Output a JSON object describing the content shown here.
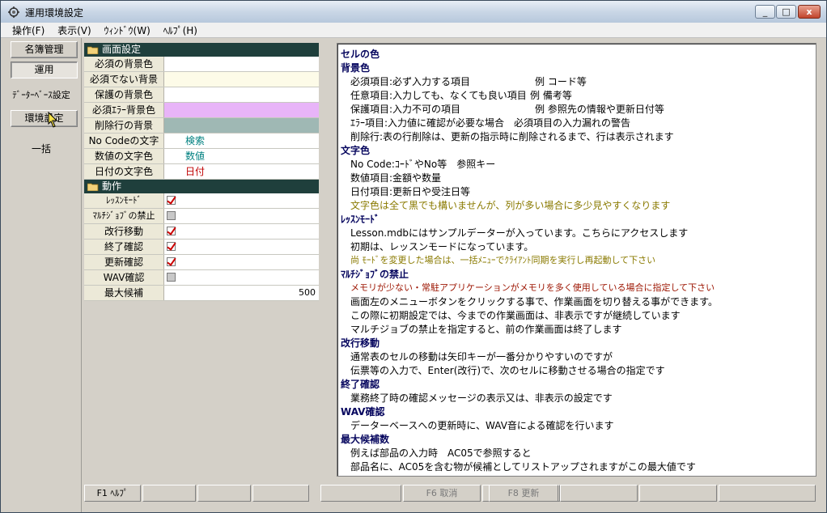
{
  "window": {
    "title": "運用環境設定",
    "icon": "app-icon",
    "buttons": {
      "minimize": "_",
      "maximize": "□",
      "close": "x"
    }
  },
  "menubar": [
    {
      "label": "操作(F)"
    },
    {
      "label": "表示(V)"
    },
    {
      "label": "ｳｨﾝﾄﾞｳ(W)"
    },
    {
      "label": "ﾍﾙﾌﾟ(H)"
    }
  ],
  "nav": {
    "master_label": "名簿管理",
    "operation_label": "運用",
    "db_settings_label": "ﾃﾞｰﾀｰﾍﾞｰｽ設定",
    "env_settings_label": "環境設定",
    "bulk_label": "一括"
  },
  "grid": {
    "screen_section": "画面設定",
    "required_bg": "必須の背景色",
    "optional_bg": "必須でない背景",
    "protected_bg": "保護の背景色",
    "required_error_bg": "必須ｴﾗｰ背景色",
    "deleted_row_bg": "削除行の背景",
    "nocode_text": "No Codeの文字",
    "nocode_value": "検索",
    "number_text": "数値の文字色",
    "number_value": "数値",
    "date_text": "日付の文字色",
    "date_value": "日付",
    "action_section": "動作",
    "lesson_mode": "ﾚｯｽﾝﾓｰﾄﾞ",
    "multi_job": "ﾏﾙﾁｼﾞｮﾌﾞの禁止",
    "line_move": "改行移動",
    "exit_confirm": "終了確認",
    "update_confirm": "更新確認",
    "wav_confirm": "WAV確認",
    "max_candidates": "最大候補",
    "max_candidates_value": "500",
    "lesson_mode_checked": true,
    "multi_job_checked": false,
    "line_move_checked": true,
    "exit_confirm_checked": true,
    "update_confirm_checked": true,
    "wav_confirm_checked": false,
    "colors": {
      "required_bg": "#ffffff",
      "optional_bg": "#fdfbe8",
      "protected_bg": "#ffffff",
      "required_error_bg": "#e8b4f8",
      "deleted_row_bg": "#9fb8b4",
      "nocode_color": "#008080",
      "number_color": "#008080",
      "date_color": "#c00000"
    }
  },
  "desc": {
    "l01": "セルの色",
    "l02": "背景色",
    "l03a": "必須項目:必ず入力する項目",
    "l03b": "例 コード等",
    "l04a": "任意項目:入力しても、なくても良い項目",
    "l04b": "例 備考等",
    "l05a": "保護項目:入力不可の項目",
    "l05b": "例 参照先の情報や更新日付等",
    "l06": "ｴﾗｰ項目:入力値に確認が必要な場合　必須項目の入力漏れの警告",
    "l07": "削除行:表の行削除は、更新の指示時に削除されるまで、行は表示されます",
    "l08": "文字色",
    "l09": "No Code:ｺｰﾄﾞやNo等　参照キー",
    "l10": "数値項目:金額や数量",
    "l11": "日付項目:更新日や受注日等",
    "l12": "文字色は全て黒でも構いませんが、列が多い場合に多少見やすくなります",
    "l13": "ﾚｯｽﾝﾓｰﾄﾞ",
    "l14": "Lesson.mdbにはサンプルデーターが入っています。こちらにアクセスします",
    "l15": "初期は、レッスンモードになっています。",
    "l16": "尚 ﾓｰﾄﾞを変更した場合は、一括ﾒﾆｭｰでｸﾗｲｱﾝﾄ同期を実行し再起動して下さい",
    "l17": "ﾏﾙﾁｼﾞｮﾌﾞの禁止",
    "l18": "メモリが少ない・常駐アプリケーションがメモリを多く使用している場合に指定して下さい",
    "l19": "画面左のメニューボタンをクリックする事で、作業画面を切り替える事ができます。",
    "l20": "この際に初期設定では、今までの作業画面は、非表示ですが継続しています",
    "l21": "マルチジョブの禁止を指定すると、前の作業画面は終了します",
    "l22": "改行移動",
    "l23": "通常表のセルの移動は矢印キーが一番分かりやすいのですが",
    "l24": "伝票等の入力で、Enter(改行)で、次のセルに移動させる場合の指定です",
    "l25": "終了確認",
    "l26": "業務終了時の確認メッセージの表示又は、非表示の設定です",
    "l27": "WAV確認",
    "l28": "データーベースへの更新時に、WAV音による確認を行います",
    "l29": "最大候補数",
    "l30": "例えば部品の入力時　AC05で参照すると",
    "l31": "部品名に、AC05を含む物が候補としてリストアップされますがこの最大値です"
  },
  "fkeys": {
    "f1": "F1 ﾍﾙﾌﾟ",
    "f6": "F6 取消",
    "f8": "F8 更新"
  }
}
